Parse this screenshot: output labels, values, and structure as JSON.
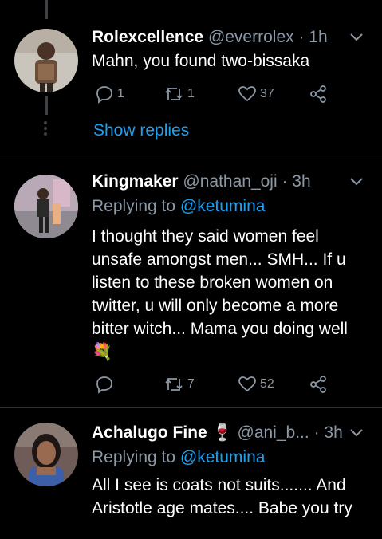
{
  "tweets": [
    {
      "name": "Rolexcellence",
      "handle": "@everrolex",
      "time": "· 1h",
      "body": "Mahn, you found two-bissaka",
      "replies": "1",
      "retweets": "1",
      "likes": "37"
    },
    {
      "name": "Kingmaker",
      "handle": "@nathan_oji",
      "time": "· 3h",
      "replying_prefix": "Replying to",
      "replying_to": "@ketumina",
      "body": "I thought they said women feel unsafe amongst men... SMH... If u listen to these broken women on twitter, u will only become a more bitter witch... Mama you doing well 💐",
      "retweets": "7",
      "likes": "52"
    },
    {
      "name": "Achalugo Fine 🍷",
      "handle": "@ani_b...",
      "time": "· 3h",
      "replying_prefix": "Replying to",
      "replying_to": "@ketumina",
      "body": "All I see is coats not suits....... And Aristotle age mates.... Babe you try"
    }
  ],
  "show_replies": "Show replies",
  "colors": {
    "link": "#1da1f2",
    "muted": "#8b98a5",
    "divider": "#2f3336"
  }
}
